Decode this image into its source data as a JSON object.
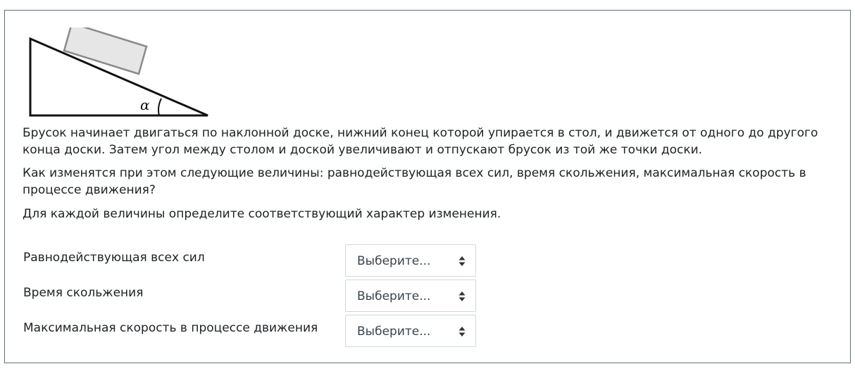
{
  "figure": {
    "angle_symbol": "α",
    "icon": "inclined-plane-with-block"
  },
  "paragraphs": [
    "Брусок начинает двигаться по наклонной доске, нижний конец которой упирается в стол, и движется от одного до другого конца доски. Затем угол между столом и доской увеличивают и отпускают брусок из той же точки доски.",
    "Как изменятся при этом следующие величины: равнодействующая всех сил, время скольжения, максимальная скорость в процессе движения?",
    "Для каждой величины определите соответствующий характер изменения."
  ],
  "rows": [
    {
      "label": "Равнодействующая всех сил",
      "select_value": "Выберите..."
    },
    {
      "label": "Время скольжения",
      "select_value": "Выберите..."
    },
    {
      "label": "Максимальная скорость в процессе движения",
      "select_value": "Выберите..."
    }
  ],
  "colors": {
    "border": "#5f6f7a",
    "text": "#1d2125",
    "block_fill": "#e6e6e6",
    "block_stroke": "#8a8a8a",
    "select_border": "#d0d8dc"
  }
}
